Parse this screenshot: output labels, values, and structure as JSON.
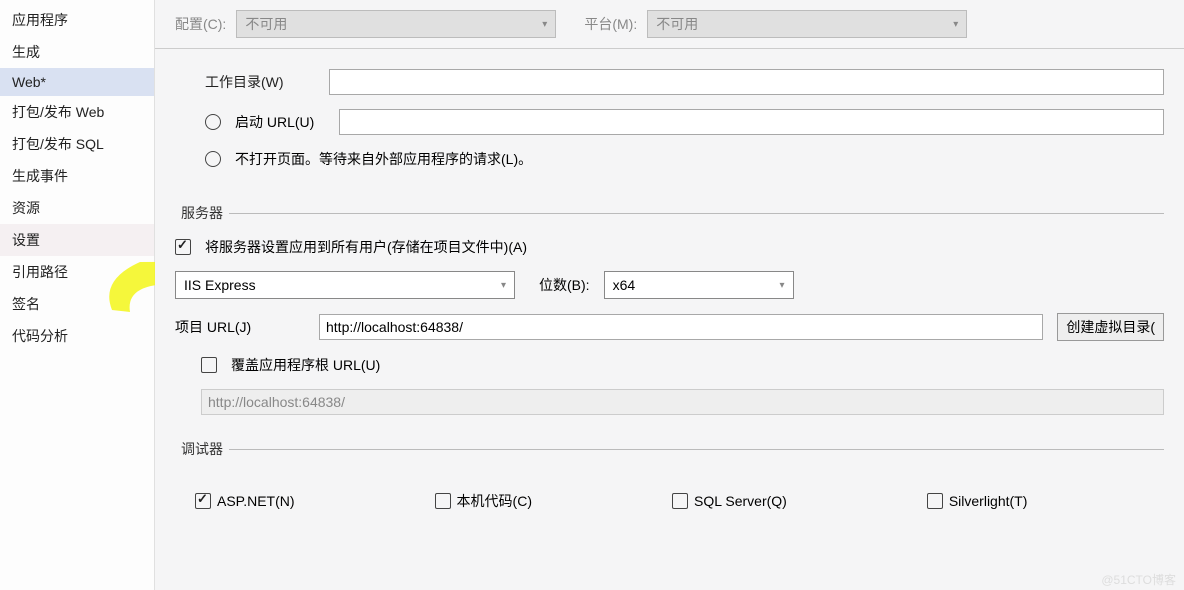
{
  "sidebar": {
    "items": [
      {
        "label": "应用程序"
      },
      {
        "label": "生成"
      },
      {
        "label": "Web*"
      },
      {
        "label": "打包/发布 Web"
      },
      {
        "label": "打包/发布 SQL"
      },
      {
        "label": "生成事件"
      },
      {
        "label": "资源"
      },
      {
        "label": "设置"
      },
      {
        "label": "引用路径"
      },
      {
        "label": "签名"
      },
      {
        "label": "代码分析"
      }
    ],
    "selected_index": 2,
    "highlight_index": 7
  },
  "toprow": {
    "config_label": "配置(C):",
    "config_value": "不可用",
    "platform_label": "平台(M):",
    "platform_value": "不可用"
  },
  "start_action": {
    "workdir_label": "工作目录(W)",
    "start_url_label": "启动 URL(U)",
    "no_open_label": "不打开页面。等待来自外部应用程序的请求(L)。"
  },
  "server": {
    "legend": "服务器",
    "apply_all_label": "将服务器设置应用到所有用户(存储在项目文件中)(A)",
    "server_type": "IIS Express",
    "bits_label": "位数(B):",
    "bits_value": "x64",
    "project_url_label": "项目 URL(J)",
    "project_url_value": "http://localhost:64838/",
    "create_vdir_label": "创建虚拟目录(",
    "override_root_label": "覆盖应用程序根 URL(U)",
    "override_root_value": "http://localhost:64838/"
  },
  "debugger": {
    "legend": "调试器",
    "aspnet": "ASP.NET(N)",
    "native": "本机代码(C)",
    "sqlserver": "SQL Server(Q)",
    "silverlight": "Silverlight(T)"
  },
  "watermark": "@51CTO博客"
}
